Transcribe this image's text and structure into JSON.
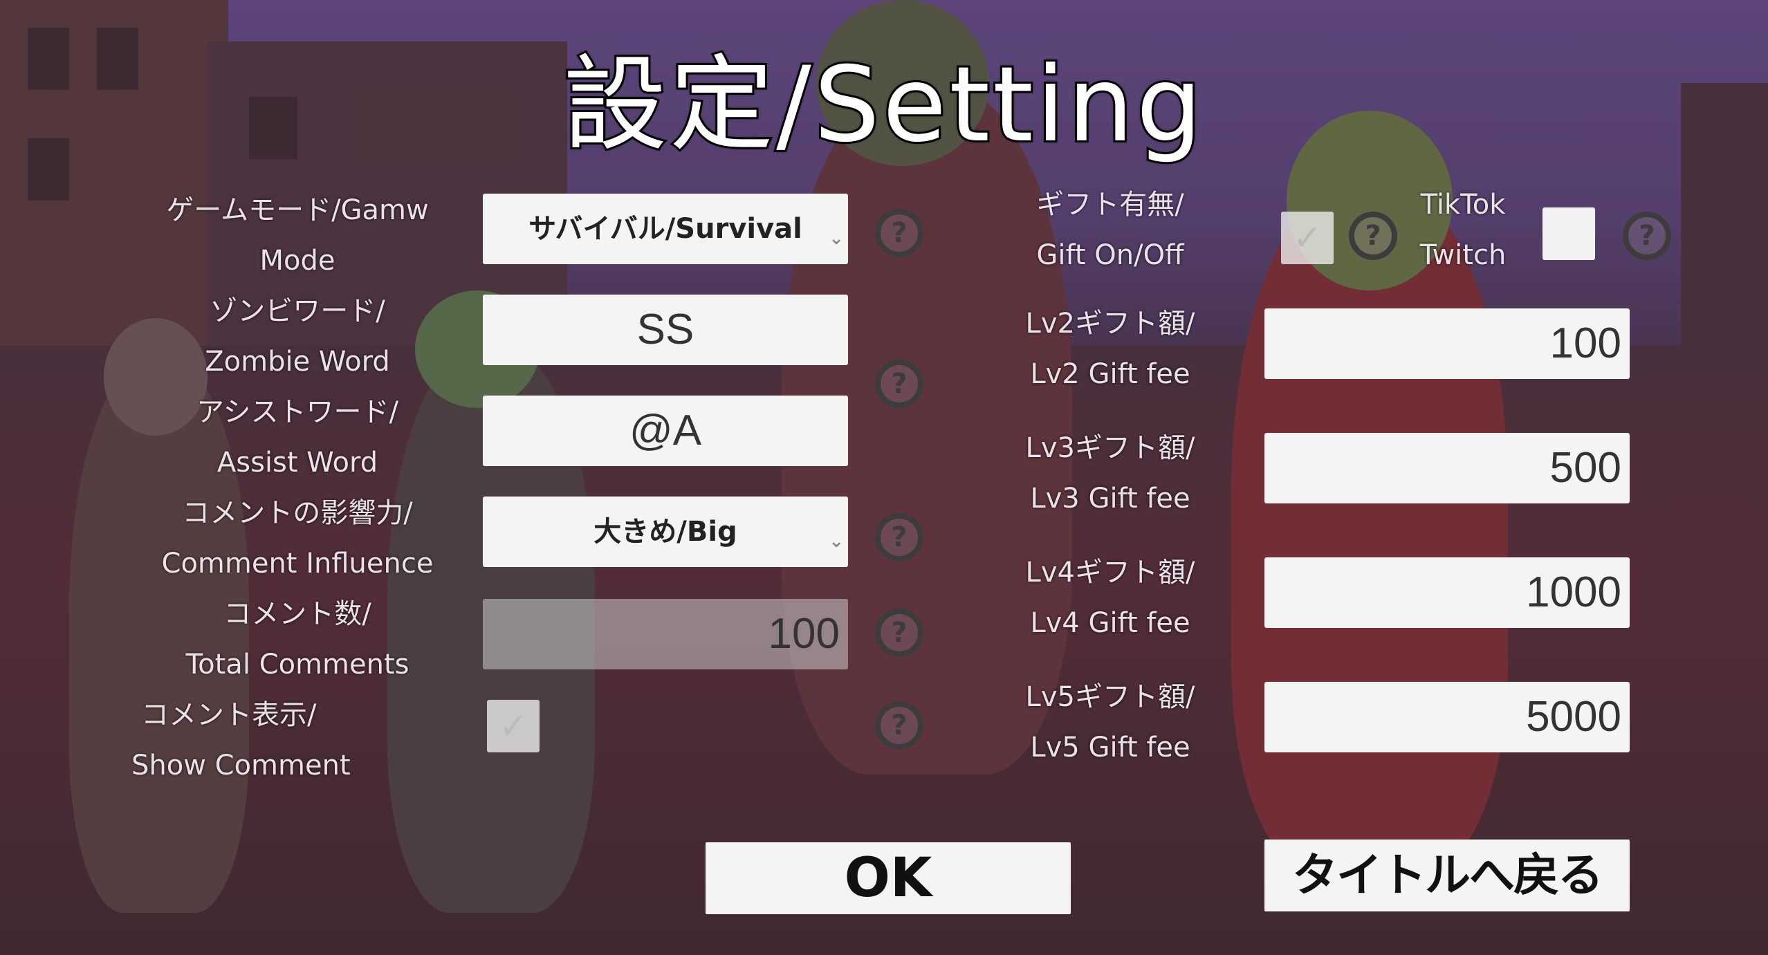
{
  "title": "設定/Setting",
  "left": {
    "game_mode": {
      "label1": "ゲームモード/Gamw",
      "label2": "Mode",
      "value": "サバイバル/Survival"
    },
    "zombie_word": {
      "label1": "ゾンビワード/",
      "label2": "Zombie Word",
      "value": "SS"
    },
    "assist_word": {
      "label1": "アシストワード/",
      "label2": "Assist Word",
      "value": "@A"
    },
    "comment_influence": {
      "label1": "コメントの影響力/",
      "label2": "Comment Influence",
      "value": "大きめ/Big"
    },
    "total_comments": {
      "label1": "コメント数/",
      "label2": "Total Comments",
      "value": "100"
    },
    "show_comment": {
      "label1": "コメント表示/",
      "label2": "Show Comment",
      "checked": true
    }
  },
  "right": {
    "gift": {
      "label1": "ギフト有無/",
      "label2": "Gift On/Off",
      "checked": true
    },
    "platform": {
      "label1": "TikTok",
      "label2": "Twitch",
      "checked": false
    },
    "lv2": {
      "label1": "Lv2ギフト額/",
      "label2": "Lv2 Gift fee",
      "value": "100"
    },
    "lv3": {
      "label1": "Lv3ギフト額/",
      "label2": "Lv3 Gift fee",
      "value": "500"
    },
    "lv4": {
      "label1": "Lv4ギフト額/",
      "label2": "Lv4 Gift fee",
      "value": "1000"
    },
    "lv5": {
      "label1": "Lv5ギフト額/",
      "label2": "Lv5 Gift fee",
      "value": "5000"
    }
  },
  "help_symbol": "?",
  "check_symbol": "✓",
  "dropdown_symbol": "⌄",
  "buttons": {
    "ok": "OK",
    "back_to_title": "タイトルへ戻る"
  }
}
